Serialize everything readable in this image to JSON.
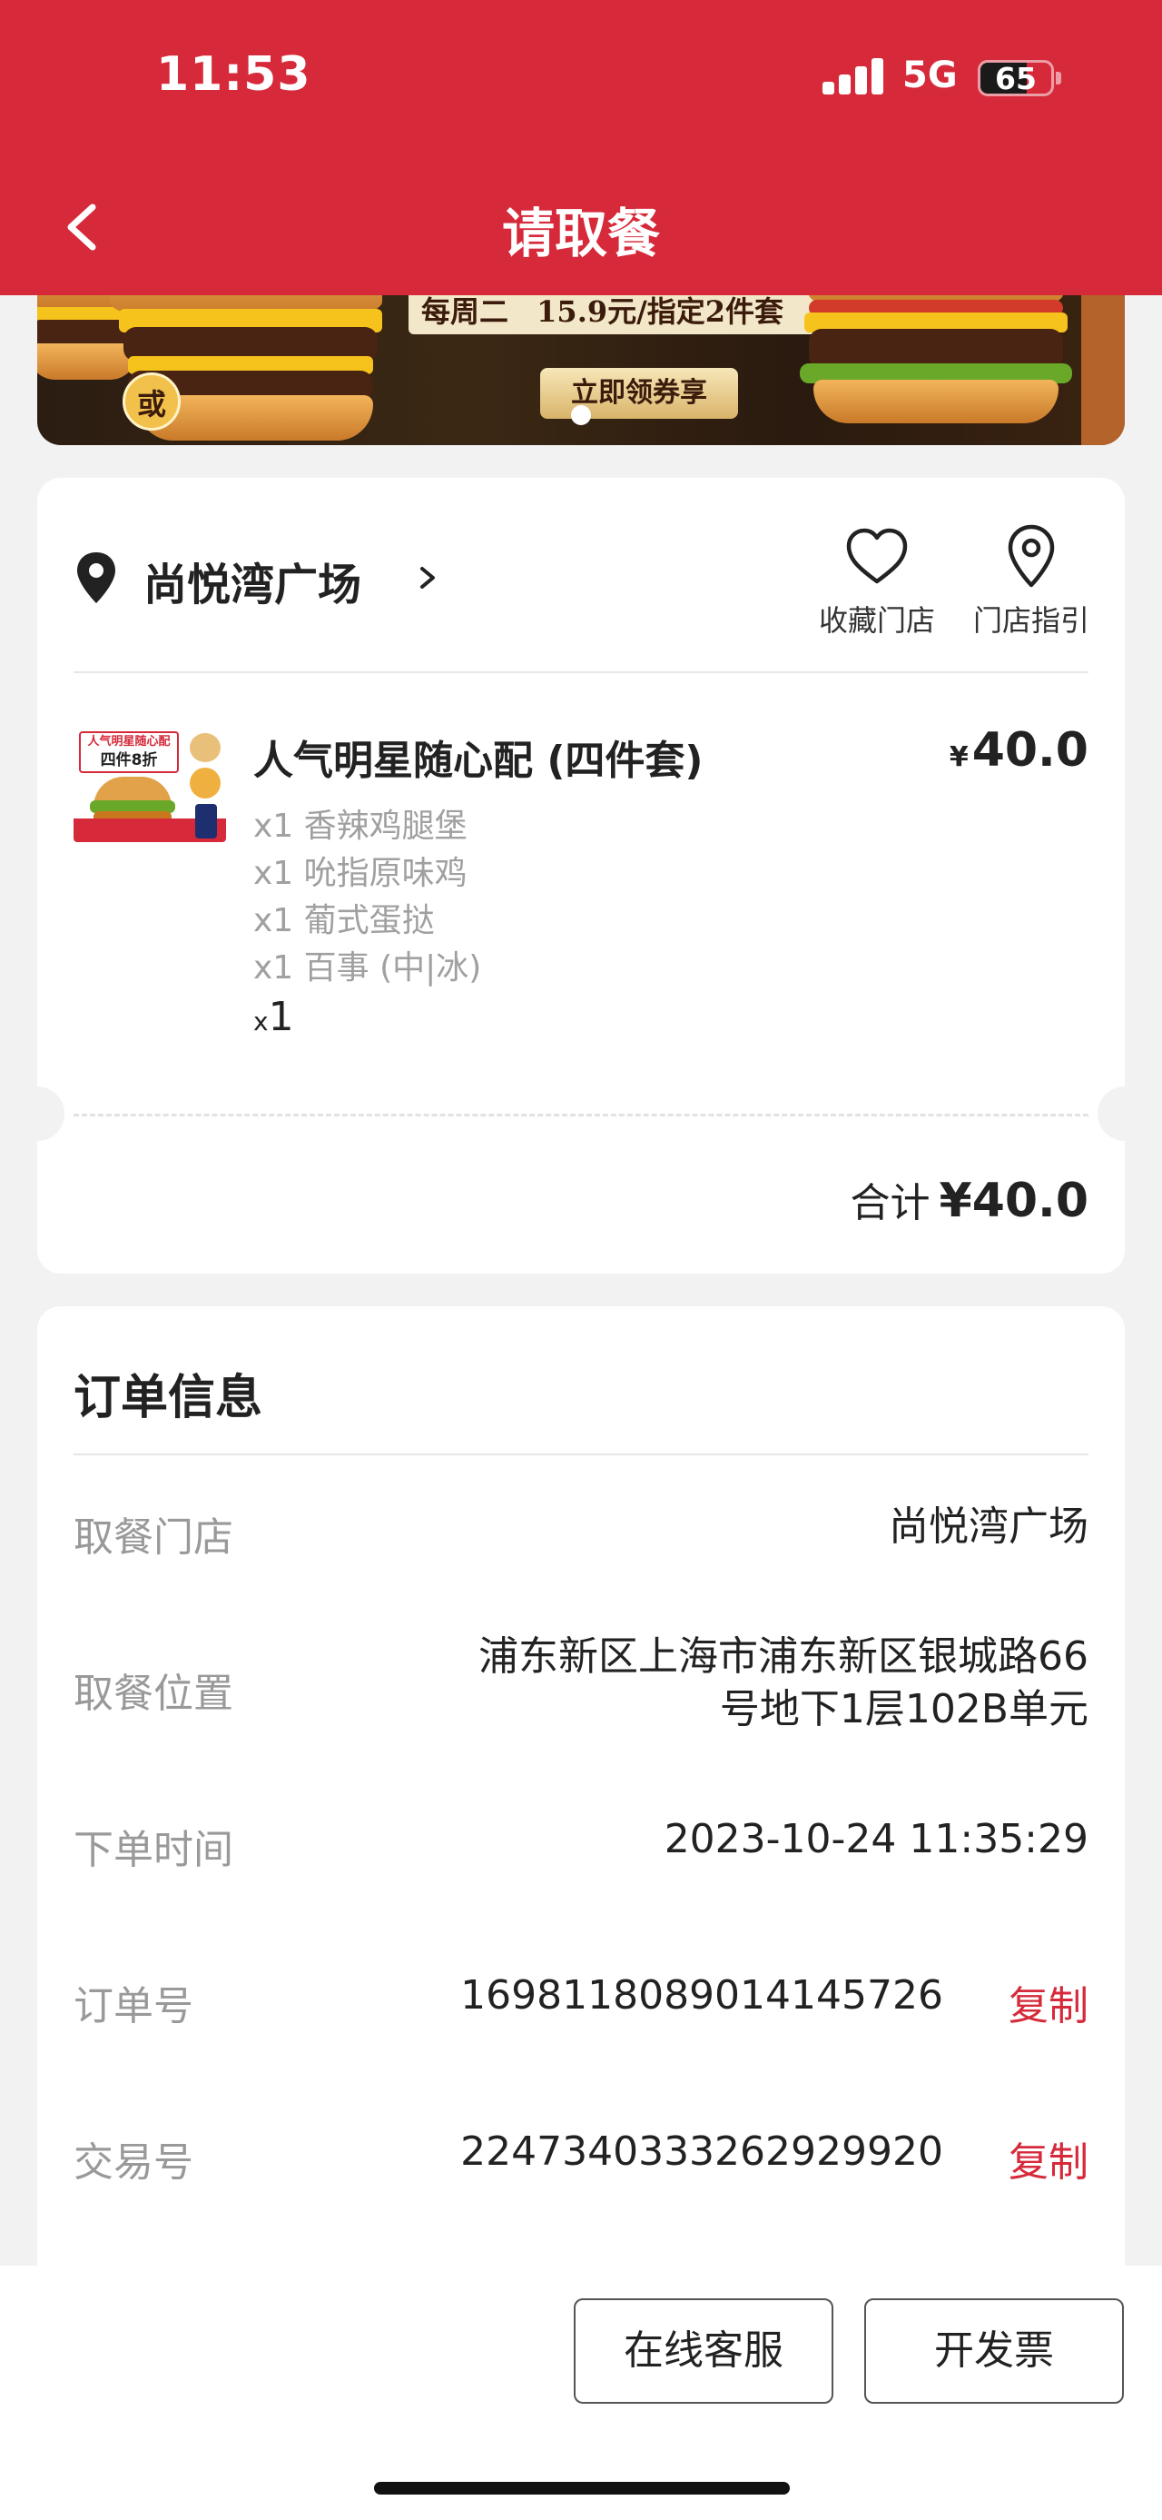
{
  "status_bar": {
    "time": "11:53",
    "network": "5G",
    "battery": "65",
    "battery_level": 0.65
  },
  "header": {
    "title": "请取餐"
  },
  "banner": {
    "promo_prefix": "每周二",
    "promo_price": "15.9元/指定2件套",
    "cta": "立即领券享",
    "or_badge": "或"
  },
  "store": {
    "name": "尚悦湾广场",
    "favorite_label": "收藏门店",
    "guide_label": "门店指引"
  },
  "product": {
    "image_text_top": "人气明星随心配",
    "image_text_main": "四件8折",
    "name": "人气明星随心配 (四件套)",
    "currency": "¥",
    "price": "40.0",
    "items": [
      "x1 香辣鸡腿堡",
      "x1 吮指原味鸡",
      "x1 葡式蛋挞",
      "x1 百事 (中|冰)"
    ],
    "qty_prefix": "x",
    "qty": "1"
  },
  "total": {
    "label": "合计",
    "amount": "¥40.0"
  },
  "order_info": {
    "title": "订单信息",
    "rows": [
      {
        "label": "取餐门店",
        "value": "尚悦湾广场"
      },
      {
        "label": "取餐位置",
        "value_line1": "浦东新区上海市浦东新区银城路66",
        "value_line2": "号地下1层102B单元"
      },
      {
        "label": "下单时间",
        "value": "2023-10-24 11:35:29"
      },
      {
        "label": "订单号",
        "value": "1698118089014145726",
        "action": "复制"
      },
      {
        "label": "交易号",
        "value": "2247340333262929920",
        "action": "复制"
      }
    ]
  },
  "bottom": {
    "service_btn": "在线客服",
    "invoice_btn": "开发票"
  },
  "colors": {
    "brand_red": "#d6293a",
    "muted": "#999999"
  }
}
